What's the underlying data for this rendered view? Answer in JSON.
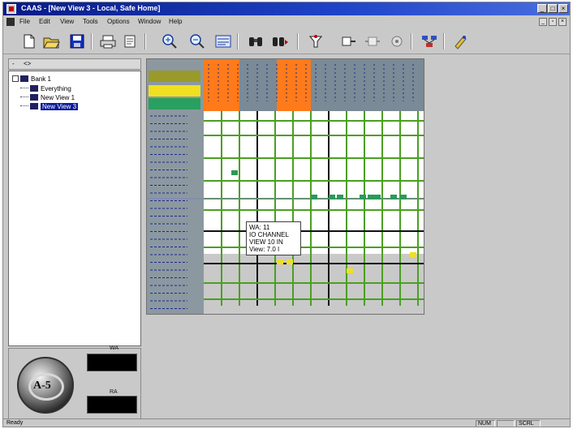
{
  "window": {
    "title": "CAAS - [New View 3 - Local, Safe Home]",
    "min_label": "_",
    "max_label": "□",
    "close_label": "×",
    "mdi_min": "_",
    "mdi_restore": "▫",
    "mdi_close": "×"
  },
  "menu": {
    "items": [
      "File",
      "Edit",
      "View",
      "Tools",
      "Options",
      "Window",
      "Help"
    ]
  },
  "toolbar": {
    "buttons": [
      "new-file-icon",
      "open-folder-icon",
      "save-icon",
      "print-icon",
      "print-preview-icon",
      "zoom-in-icon",
      "zoom-out-icon",
      "fit-view-icon",
      "binoculars-icon",
      "find-next-icon",
      "connect-icon",
      "link-icon",
      "disconnect-icon",
      "settings-icon",
      "network-icon",
      "help-icon"
    ]
  },
  "tree": {
    "header_left": "-",
    "header_right": "<>",
    "root_label": "Bank 1",
    "items": [
      "Everything",
      "New View 1",
      "New View 3"
    ],
    "selected": "New View 3"
  },
  "readouts": {
    "label1": "WA",
    "label2": "RA",
    "value1": "",
    "value2": ""
  },
  "logo": {
    "text": "A-5"
  },
  "tooltip": {
    "lines": [
      "WA: 11",
      "IO CHANNEL",
      "VIEW 10 IN",
      "View: 7.0 I"
    ]
  },
  "status": {
    "left": "Ready",
    "cell1": "NUM",
    "cell2": "",
    "cell3": "SCRL"
  },
  "grid": {
    "header_bg": "#7a8a96",
    "left_column_bg": "#8c98a0",
    "orange": "#ff7a1a",
    "green_line": "#4aa020",
    "green_marker": "#2a9a5a",
    "yellow_marker": "#f0e020"
  }
}
